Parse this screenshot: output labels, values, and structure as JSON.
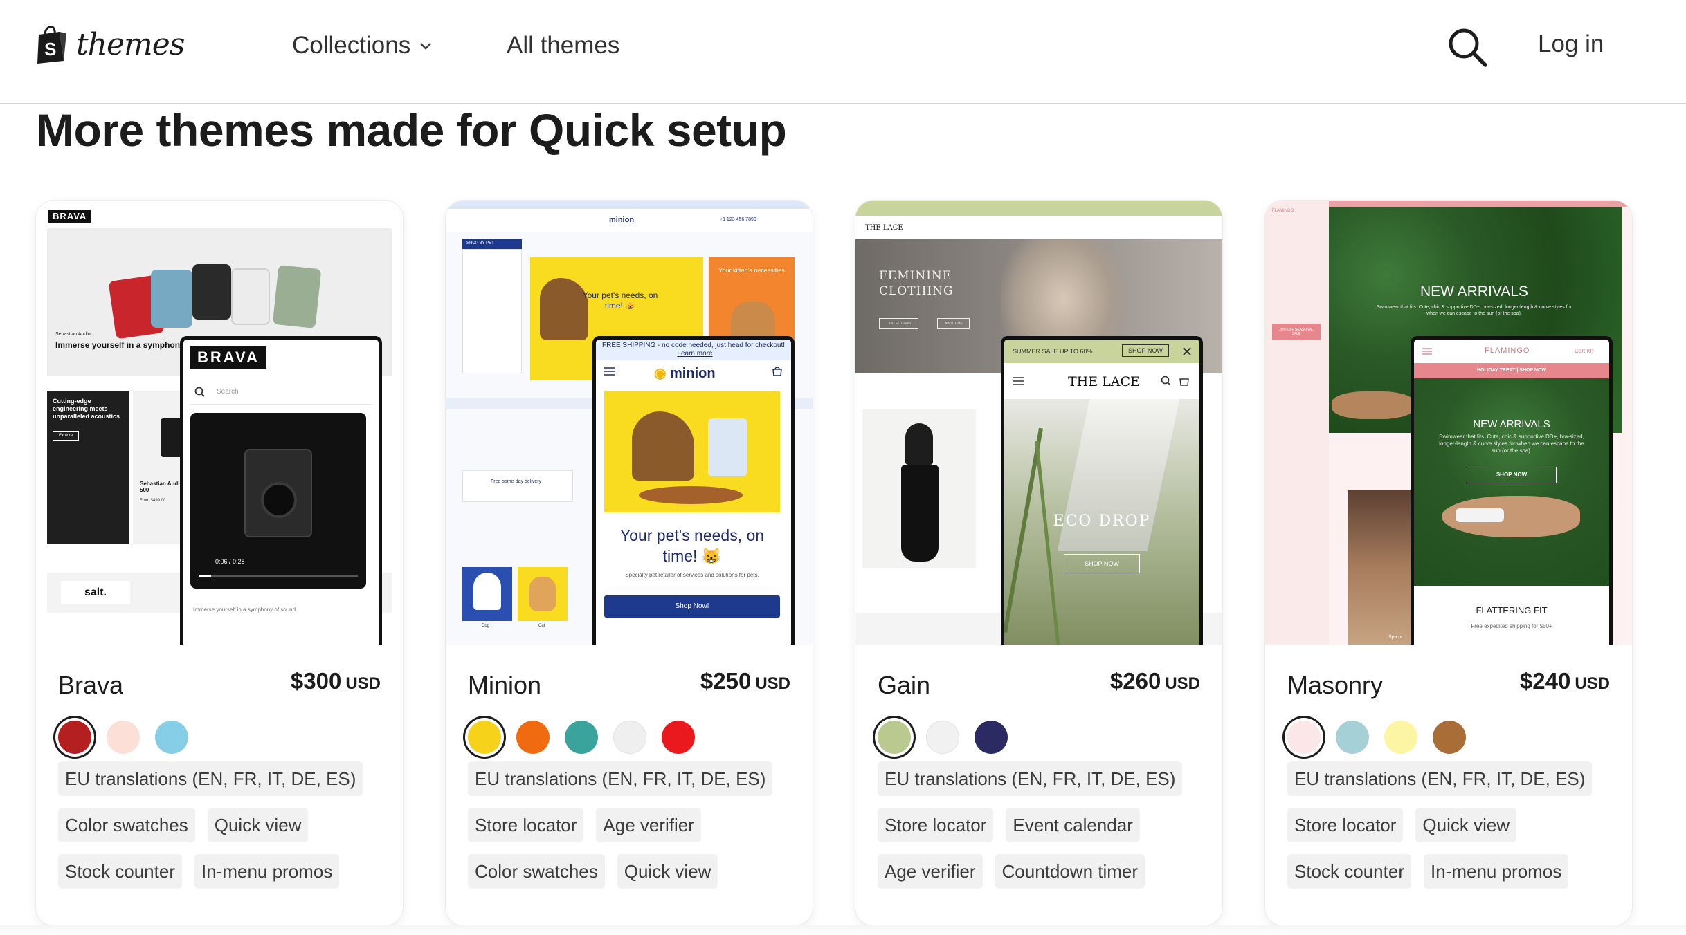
{
  "header": {
    "logo_text": "themes",
    "nav": [
      {
        "label": "Collections",
        "has_dropdown": true
      },
      {
        "label": "All themes",
        "has_dropdown": false
      }
    ],
    "login_label": "Log in"
  },
  "section": {
    "title": "More themes made for Quick setup"
  },
  "themes": [
    {
      "name": "Brava",
      "price": "$300",
      "currency": "USD",
      "swatches": [
        "#b41f1f",
        "#fcdfd6",
        "#86cde6"
      ],
      "selected_swatch": 0,
      "tags": [
        [
          "EU translations (EN, FR, IT, DE, ES)"
        ],
        [
          "Color swatches",
          "Quick view"
        ],
        [
          "Stock counter",
          "In-menu promos"
        ]
      ],
      "preview": {
        "brand": "BRAVA",
        "hero_caption": "Immerse yourself in a symphony of sound",
        "hero_small": "Sebastian Audio",
        "promo": "Cutting-edge engineering meets unparalleled acoustics",
        "promo_button": "Explore",
        "product": "Sebastian Audio Speaker 500",
        "product_price": "From $499.00",
        "footer_brand": "salt.",
        "video_time": "0:06 / 0:28",
        "search_placeholder": "Search",
        "phone_caption": "Immerse yourself in a symphony of sound"
      }
    },
    {
      "name": "Minion",
      "price": "$250",
      "currency": "USD",
      "swatches": [
        "#f7d21a",
        "#f06a0f",
        "#3aa39c",
        "#efefef",
        "#e9191e"
      ],
      "selected_swatch": 0,
      "tags": [
        [
          "EU translations (EN, FR, IT, DE, ES)"
        ],
        [
          "Store locator",
          "Age verifier"
        ],
        [
          "Color swatches",
          "Quick view"
        ]
      ],
      "preview": {
        "brand": "minion",
        "banner": "FREE SHIPPING - no code needed, just head for checkout!",
        "banner_link": "Learn more",
        "hero_heading": "Your pet's needs, on time! 😸",
        "hero_sub": "Specialty pet retailer of services and solutions for pets.",
        "hero_button": "Shop Now!",
        "side_promo": "Your kitten's necessities",
        "shop_by_pet": "SHOP BY PET",
        "delivery": "Free same-day delivery",
        "cat_dog": "Dog",
        "cat_cat": "Cat",
        "phone_number": "+1 123 456 7890"
      }
    },
    {
      "name": "Gain",
      "price": "$260",
      "currency": "USD",
      "swatches": [
        "#b9c98f",
        "#f1f1f1",
        "#2b2a63"
      ],
      "selected_swatch": 0,
      "tags": [
        [
          "EU translations (EN, FR, IT, DE, ES)"
        ],
        [
          "Store locator",
          "Event calendar"
        ],
        [
          "Age verifier",
          "Countdown timer"
        ]
      ],
      "preview": {
        "brand": "THE LACE",
        "hero_heading": "FEMININE CLOTHING",
        "top_banner": "SUMMER SALE UP TO 60%",
        "top_button": "SHOP NOW",
        "phone_hero": "ECO DROP",
        "phone_button": "SHOP NOW",
        "desk_btn_1": "COLLECTIONS",
        "desk_btn_2": "ABOUT US"
      }
    },
    {
      "name": "Masonry",
      "price": "$240",
      "currency": "USD",
      "swatches": [
        "#fbe6e8",
        "#a5d1d6",
        "#fbf5a4",
        "#a96d38"
      ],
      "selected_swatch": 0,
      "tags": [
        [
          "EU translations (EN, FR, IT, DE, ES)"
        ],
        [
          "Store locator",
          "Quick view"
        ],
        [
          "Stock counter",
          "In-menu promos"
        ]
      ],
      "preview": {
        "brand": "FLAMINGO",
        "hero_heading": "NEW ARRIVALS",
        "hero_sub": "Swimwear that fits. Cute, chic & supportive DD+, bra-sized, longer-length & curve styles for when we can escape to the sun (or the spa).",
        "promo_bar": "HOLIDAY TREAT | SHOP NOW",
        "phone_button": "SHOP NOW",
        "phone_cart": "Cart (0)",
        "section_heading": "FLATTERING FIT",
        "section_sub": "Free expedited shipping for $50+",
        "side_badge": "20% OFF SEASONAL SALE",
        "spa_caption": "Spa or"
      }
    }
  ]
}
